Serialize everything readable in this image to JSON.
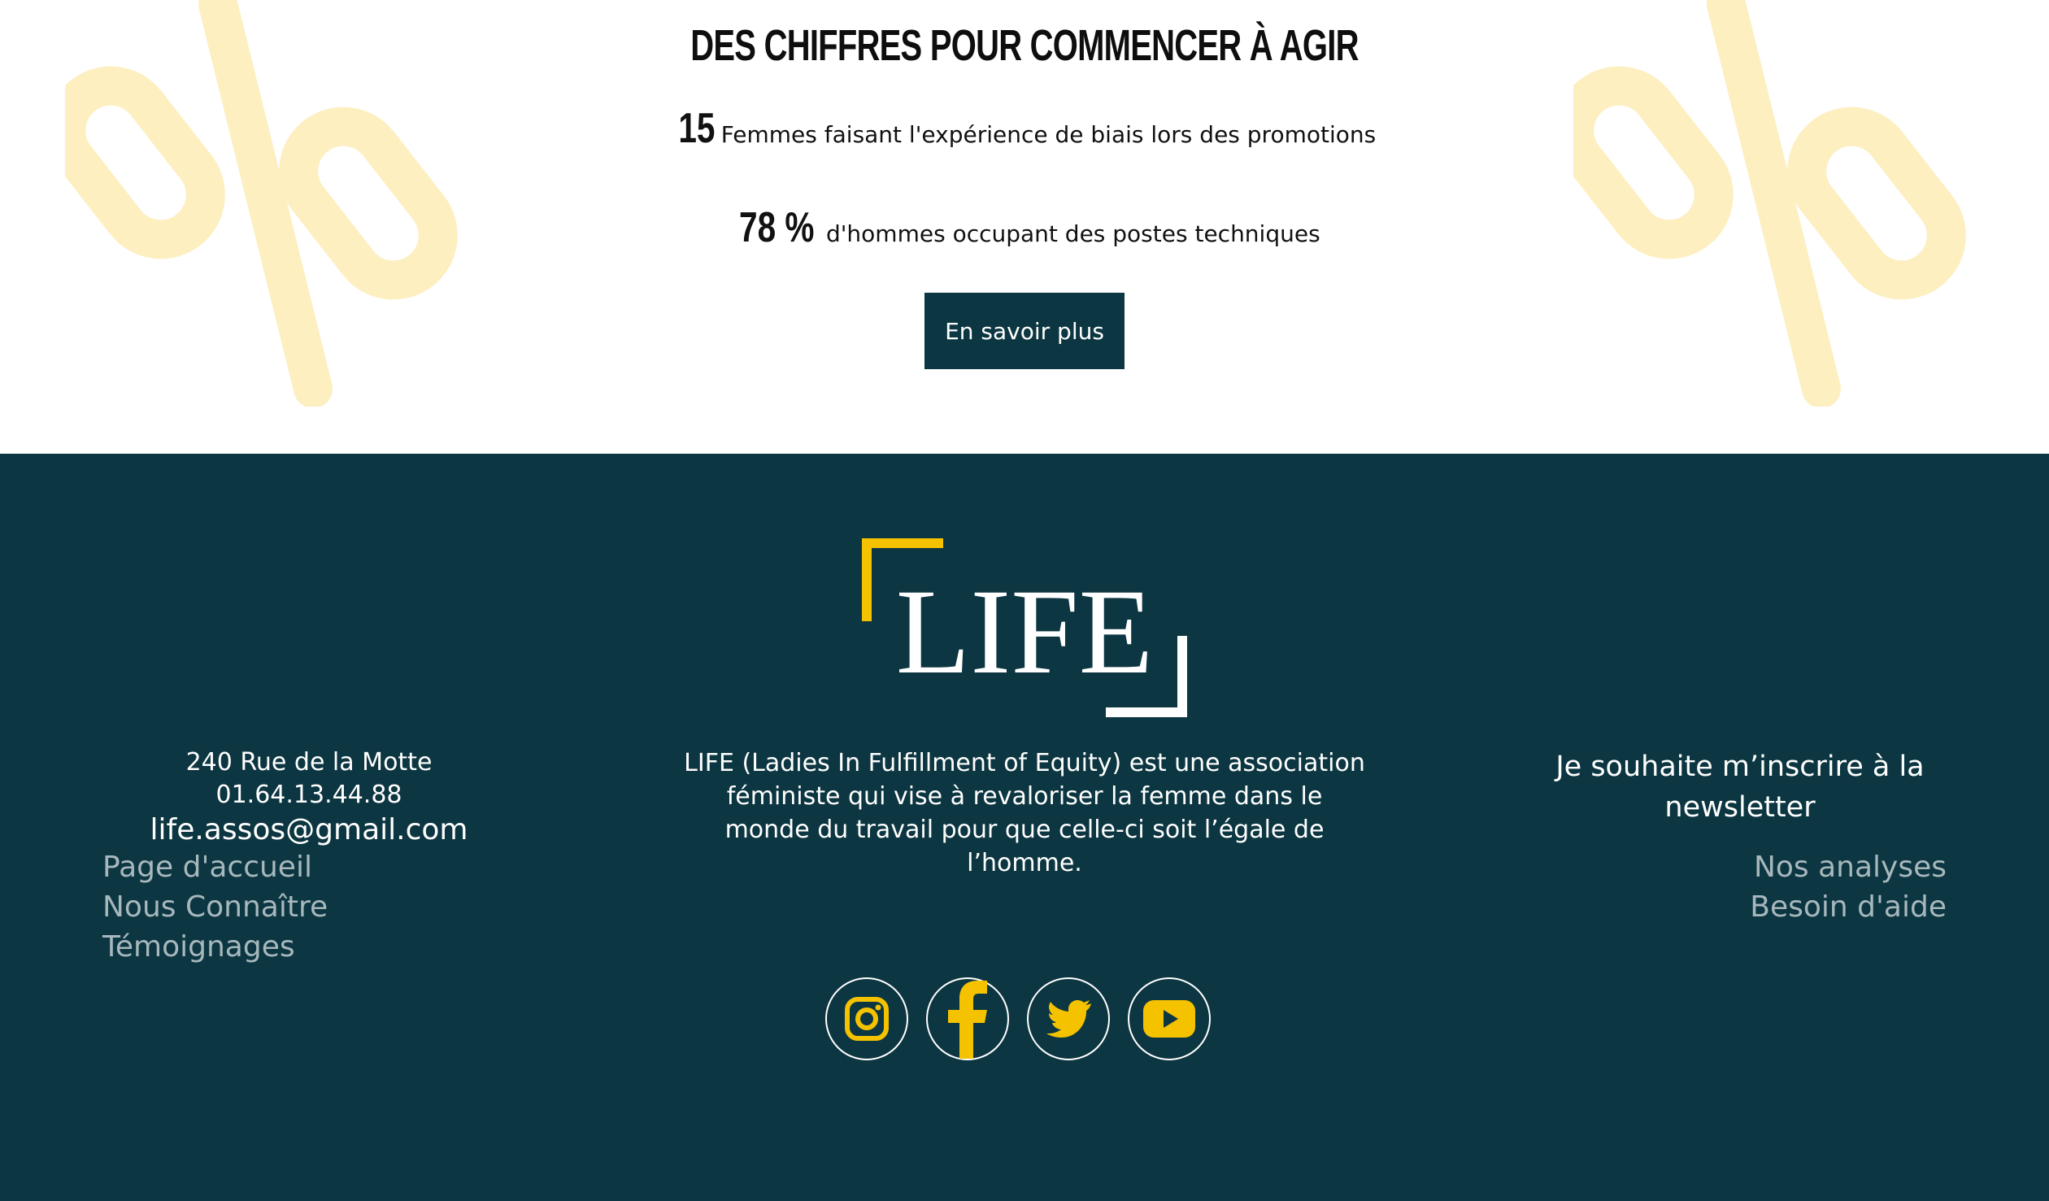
{
  "stats_section": {
    "title": "DES CHIFFRES POUR COMMENCER À AGIR",
    "stats": [
      {
        "number": "15",
        "text": "Femmes faisant l'expérience de biais lors des promotions"
      },
      {
        "number": "78 %",
        "text": "d'hommes occupant des postes techniques"
      }
    ],
    "cta_label": "En savoir plus",
    "decoration_icon": "percent-sign"
  },
  "footer": {
    "logo_text": "LIFE",
    "address": {
      "street": "240 Rue de la Motte",
      "phone": "01.64.13.44.88",
      "email": "life.assos@gmail.com"
    },
    "about_text": "LIFE (Ladies In Fulfillment of Equity) est une association féministe qui vise à revaloriser la femme dans le monde du travail pour que celle-ci soit l’égale de l’homme.",
    "newsletter_label": "Je souhaite m’inscrire à la newsletter",
    "nav_left": [
      "Page d'accueil",
      "Nous Connaître",
      "Témoignages"
    ],
    "nav_right": [
      "Nos analyses",
      "Besoin d'aide"
    ],
    "socials": [
      "instagram-icon",
      "facebook-icon",
      "twitter-icon",
      "youtube-icon"
    ]
  },
  "colors": {
    "footer_bg": "#0c3641",
    "accent_yellow": "#f5c200",
    "decoration_yellow": "#fdefc0",
    "nav_text": "#a7b8bd"
  }
}
